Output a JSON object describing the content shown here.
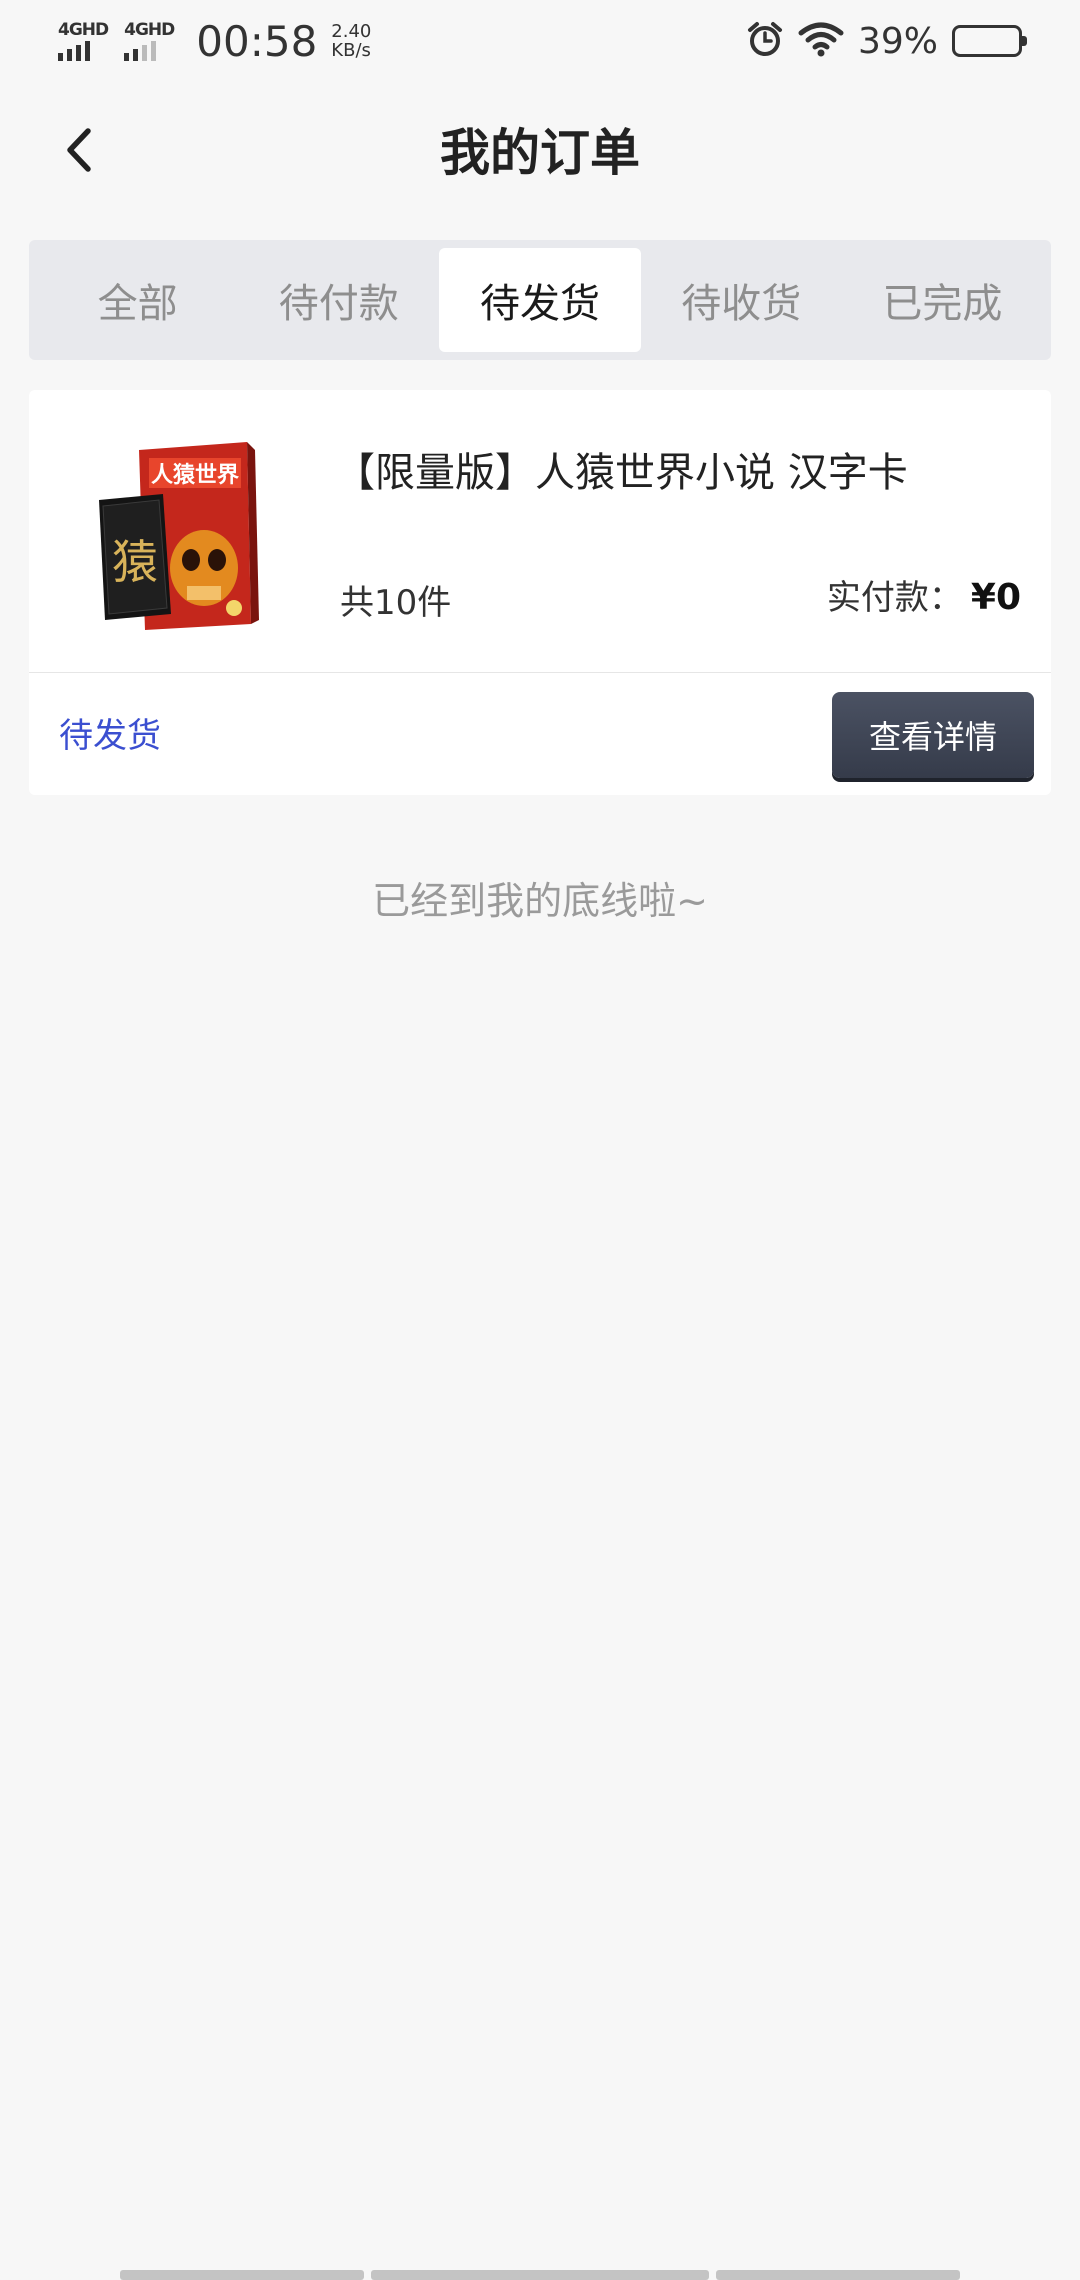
{
  "status_bar": {
    "sim1": "4GHD",
    "sim2": "4GHD",
    "time": "00:58",
    "net_speed_value": "2.40",
    "net_speed_unit": "KB/s",
    "battery": "39%",
    "battery_level": 0.39
  },
  "header": {
    "title": "我的订单"
  },
  "tabs": [
    {
      "label": "全部"
    },
    {
      "label": "待付款"
    },
    {
      "label": "待发货"
    },
    {
      "label": "待收货"
    },
    {
      "label": "已完成"
    }
  ],
  "active_tab": "待发货",
  "order": {
    "product_name": "【限量版】人猿世界小说 汉字卡",
    "quantity": "共10件",
    "paid_label": "实付款：",
    "paid_amount": "¥0",
    "status": "待发货",
    "detail_button": "查看详情",
    "thumb": {
      "book_title": "人猿世界",
      "card_glyph": "猿"
    }
  },
  "end_note": "已经到我的底线啦~",
  "colors": {
    "accent": "#3b4fd0",
    "button": "#3f4555",
    "background": "#f7f7f7"
  }
}
